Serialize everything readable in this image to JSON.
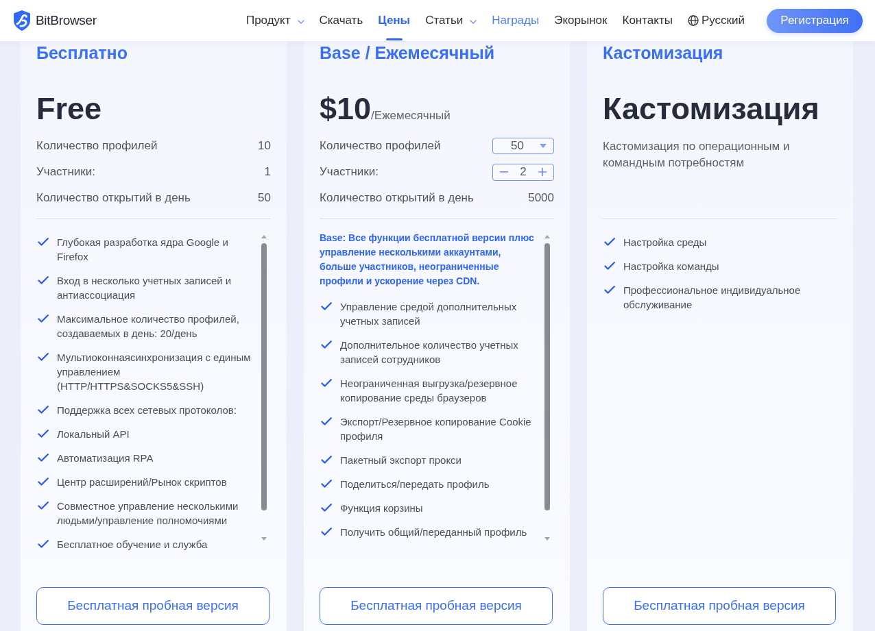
{
  "header": {
    "brand": "BitBrowser",
    "nav": [
      {
        "label": "Продукт",
        "has_menu": true,
        "selected": false,
        "highlighted": false
      },
      {
        "label": "Скачать",
        "has_menu": false,
        "selected": false,
        "highlighted": false
      },
      {
        "label": "Цены",
        "has_menu": false,
        "selected": true,
        "highlighted": false
      },
      {
        "label": "Статьи",
        "has_menu": true,
        "selected": false,
        "highlighted": false
      },
      {
        "label": "Награды",
        "has_menu": false,
        "selected": false,
        "highlighted": true
      },
      {
        "label": "Экорынок",
        "has_menu": false,
        "selected": false,
        "highlighted": false
      },
      {
        "label": "Контакты",
        "has_menu": false,
        "selected": false,
        "highlighted": false
      }
    ],
    "language": "Русский",
    "register_button": "Регистрация"
  },
  "plans": [
    {
      "tier": "Бесплатно",
      "price": "Free",
      "specs": [
        {
          "label": "Количество профилей",
          "kind": "value",
          "value": "10"
        },
        {
          "label": "Участники:",
          "kind": "value",
          "value": "1"
        },
        {
          "label": "Количество открытий в день",
          "kind": "value",
          "value": "50"
        }
      ],
      "scrollable": true,
      "features": [
        "Глубокая разработка ядра Google и Firefox",
        "Вход в несколько учетных записей и антиассоциация",
        "Максимальное количество профилей, создаваемых в день: 20/день",
        "Мультиоконнаясинхронизация с единым управлением (HTTP/HTTPS&SOCKS5&SSH)",
        "Поддержка всех сетевых протоколов:",
        "Локальный API",
        "Автоматизация RPA",
        "Центр расширений/Рынок скриптов",
        "Совместное управление несколькими людьми/управление полномочиями",
        "Бесплатное обучение и служба"
      ],
      "button": "Бесплатная пробная версия"
    },
    {
      "tier": "Base / Ежемесячный",
      "price": "$10",
      "period": "/Ежемесячный",
      "specs": [
        {
          "label": "Количество профилей",
          "kind": "select",
          "value": "50"
        },
        {
          "label": "Участники:",
          "kind": "stepper",
          "value": "2"
        },
        {
          "label": "Количество открытий в день",
          "kind": "value",
          "value": "5000"
        }
      ],
      "summary": "Base: Все функции бесплатной версии плюс управление несколькими аккаунтами, больше участников, неограниченные профили и ускорение через CDN.",
      "scrollable": true,
      "features": [
        "Управление средой дополнительных учетных записей",
        "Дополнительное количество учетных записей сотрудников",
        "Неограниченная выгрузка/резервное копирование среды браузеров",
        "Экспорт/Резервное копирование Cookie профиля",
        "Пакетный экспорт прокси",
        "Поделиться/передать профиль",
        "Функция корзины",
        "Получить общий/переданный профиль"
      ],
      "button": "Бесплатная пробная версия"
    },
    {
      "tier": "Кастомизация",
      "price": "Кастомизация",
      "description": "Кастомизация по операционным и командным потребностям",
      "scrollable": false,
      "features": [
        "Настройка среды",
        "Настройка команды",
        "Профессиональное индивидуальное обслуживание"
      ],
      "button": "Бесплатная пробная версия"
    }
  ]
}
